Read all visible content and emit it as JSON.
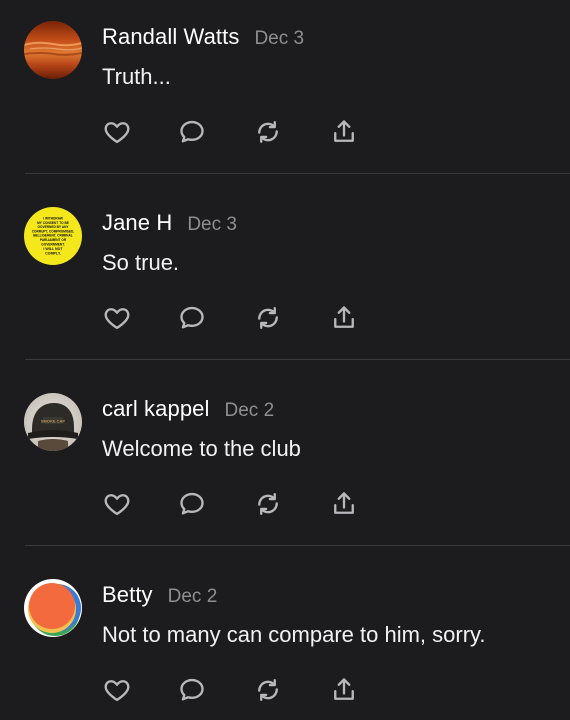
{
  "comments": [
    {
      "author": "Randall Watts",
      "date": "Dec 3",
      "text": "Truth...",
      "avatar_icon": "sunset-photo",
      "avatar_colors": [
        "#c24a14",
        "#8a2a08",
        "#e88a3a"
      ]
    },
    {
      "author": "Jane H",
      "date": "Dec 3",
      "text": "So true.",
      "avatar_icon": "yellow-sticker-text",
      "avatar_text": [
        "I WITHDRAW",
        "MY CONSENT TO BE",
        "GOVERNED BY ANY",
        "CORRUPT, COMPROMISED,",
        "BELLIGERENT, CRIMINAL",
        "PARLIAMENT OR",
        "GOVERNMENT.",
        "I WILL NOT",
        "COMPLY."
      ],
      "avatar_colors": [
        "#f4e81c",
        "#111111"
      ]
    },
    {
      "author": "carl kappel",
      "date": "Dec 2",
      "text": "Welcome to the club",
      "avatar_icon": "person-in-cap-photo",
      "avatar_text": [
        "SMOKE CAP"
      ],
      "avatar_colors": [
        "#d9d4cc",
        "#2c2b27"
      ]
    },
    {
      "author": "Betty",
      "date": "Dec 2",
      "text": "Not to many can compare to him, sorry.",
      "avatar_icon": "colorful-circle-logo",
      "avatar_colors": [
        "#f26a3d",
        "#3a7bd5",
        "#3aa655",
        "#f2c14e"
      ]
    }
  ],
  "actions": [
    {
      "name": "like",
      "icon": "heart-icon"
    },
    {
      "name": "reply",
      "icon": "comment-bubble-icon"
    },
    {
      "name": "restack",
      "icon": "refresh-icon"
    },
    {
      "name": "share",
      "icon": "share-icon"
    }
  ],
  "colors": {
    "background": "#1c1c1e",
    "text": "#ffffff",
    "muted": "#8e8e93",
    "icon": "#b8b8bc",
    "divider": "#3a3a3c"
  }
}
